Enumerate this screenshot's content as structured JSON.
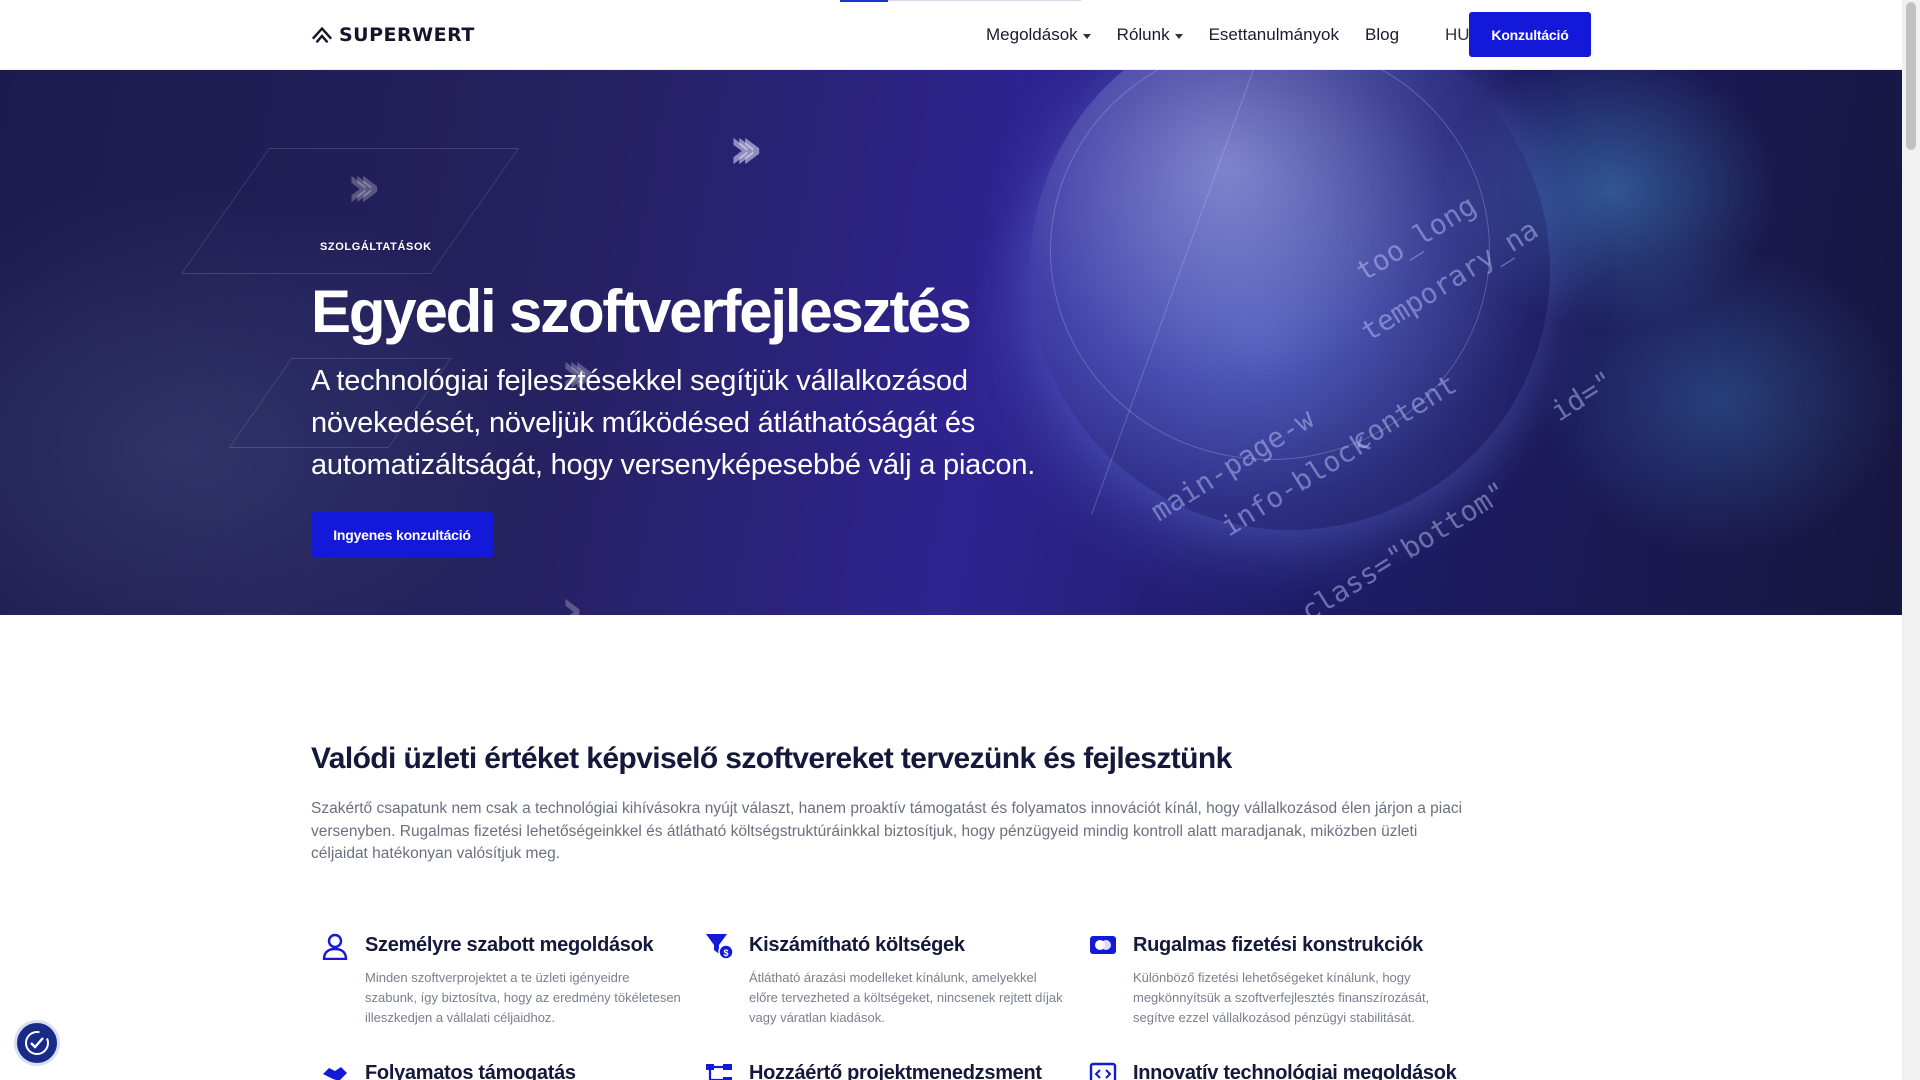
{
  "brand": {
    "name": "SUPERWERT"
  },
  "nav": {
    "items": [
      {
        "label": "Megoldások",
        "has_dropdown": true
      },
      {
        "label": "Rólunk",
        "has_dropdown": true
      },
      {
        "label": "Esettanulmányok",
        "has_dropdown": false
      },
      {
        "label": "Blog",
        "has_dropdown": false
      }
    ],
    "language": "HU",
    "cta": "Konzultáció"
  },
  "hero": {
    "eyebrow": "SZOLGÁLTATÁSOK",
    "title": "Egyedi szoftverfejlesztés",
    "subtitle": "A technológiai fejlesztésekkel segítjük vállalkozásod növekedését, növeljük működésed átláthatóságát és automatizáltságát, hogy versenyképesebbé válj a piacon.",
    "cta": "Ingyenes konzultáció",
    "code_lines": [
      "main-page-w",
      "info-block",
      "content",
      "class=\"bottom\"",
      "temporary_na",
      "too_long",
      "id=\""
    ]
  },
  "intro": {
    "title": "Valódi üzleti értéket képviselő szoftvereket tervezünk és fejlesztünk",
    "body": "Szakértő csapatunk nem csak a technológiai kihívásokra nyújt választ, hanem proaktív támogatást és folyamatos innovációt kínál, hogy vállalkozásod élen járjon a piaci versenyben. Rugalmas fizetési lehetőségeinkkel és átlátható költségstruktúráinkkal biztosítjuk, hogy pénzügyeid mindig kontroll alatt maradjanak, miközben üzleti céljaidat hatékonyan valósítjuk meg."
  },
  "features": [
    {
      "icon": "user-icon",
      "title": "Személyre szabott megoldások",
      "desc": "Minden szoftverprojektet a te üzleti igényeidre szabunk, így biztosítva, hogy az eredmény tökéletesen illeszkedjen a vállalati céljaidhoz."
    },
    {
      "icon": "cost-funnel-icon",
      "title": "Kiszámítható költségek",
      "desc": "Átlátható árazási modelleket kínálunk, amelyekkel előre tervezheted a költségeket, nincsenek rejtett díjak vagy váratlan kiadások."
    },
    {
      "icon": "payment-card-icon",
      "title": "Rugalmas fizetési konstrukciók",
      "desc": "Különböző fizetési lehetőségeket kínálunk, hogy megkönnyítsük a szoftverfejlesztés finanszírozását, segítve ezzel vállalkozásod pénzügyi stabilitását."
    },
    {
      "icon": "handshake-icon",
      "title": "Folyamatos támogatás",
      "desc": ""
    },
    {
      "icon": "project-tree-icon",
      "title": "Hozzáértő projektmenedzsment",
      "desc": ""
    },
    {
      "icon": "code-window-icon",
      "title": "Innovatív technológiai megoldások",
      "desc": ""
    }
  ],
  "colors": {
    "primary": "#1418d8",
    "heading": "#14183a",
    "body_text": "#6b7080",
    "hero_bg": "#262160"
  }
}
